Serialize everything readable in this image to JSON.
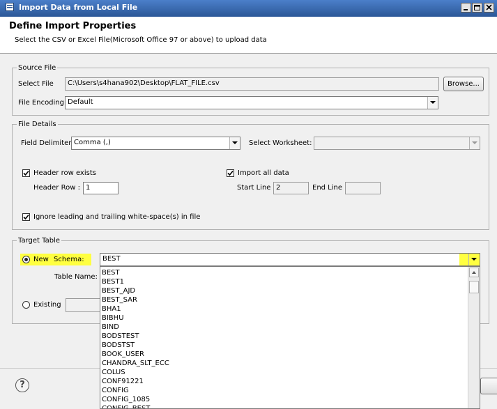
{
  "window": {
    "title": "Import Data from Local File"
  },
  "header": {
    "title": "Define Import Properties",
    "subtitle": "Select the CSV or Excel File(Microsoft Office 97 or above) to upload data"
  },
  "source_file": {
    "legend": "Source File",
    "select_file_label": "Select File",
    "select_file_value": "C:\\Users\\s4hana902\\Desktop\\FLAT_FILE.csv",
    "browse_label": "Browse...",
    "encoding_label": "File Encoding",
    "encoding_value": "Default"
  },
  "file_details": {
    "legend": "File Details",
    "delimiter_label": "Field Delimiter",
    "delimiter_value": "Comma (,)",
    "worksheet_label": "Select Worksheet:",
    "worksheet_value": "",
    "header_row_exists_label": "Header row exists",
    "header_row_exists_checked": true,
    "header_row_label": "Header Row :",
    "header_row_value": "1",
    "import_all_label": "Import all data",
    "import_all_checked": true,
    "start_line_label": "Start Line",
    "start_line_value": "2",
    "end_line_label": "End Line",
    "end_line_value": "",
    "ignore_ws_label": "Ignore leading and trailing white-space(s) in file",
    "ignore_ws_checked": true
  },
  "target_table": {
    "legend": "Target Table",
    "new_label": "New",
    "new_selected": true,
    "schema_label": "Schema:",
    "schema_value": "BEST",
    "table_name_label": "Table Name:",
    "existing_label": "Existing",
    "highlight_color": "#ffff40",
    "schema_options": [
      "BEST",
      "BEST1",
      "BEST_AJD",
      "BEST_SAR",
      "BHA1",
      "BIBHU",
      "BIND",
      "BODSTEST",
      "BODSTST",
      "BOOK_USER",
      "CHANDRA_SLT_ECC",
      "COLUS",
      "CONF91221",
      "CONFIG",
      "CONFIG_1085",
      "CONFIG_BEST"
    ]
  },
  "footer": {
    "help_icon": "question-mark-icon"
  }
}
